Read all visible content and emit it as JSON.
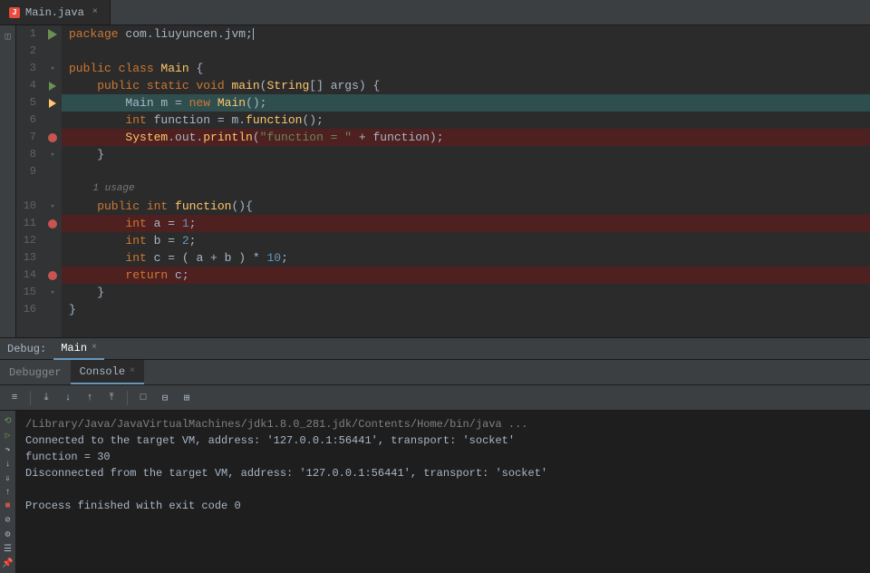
{
  "tab": {
    "label": "Main.java",
    "icon_text": "J"
  },
  "editor": {
    "lines": [
      {
        "num": 1,
        "type": "normal",
        "tokens": [
          {
            "t": "kw",
            "v": "package "
          },
          {
            "t": "pkg",
            "v": "com.liuyuncen.jvm"
          },
          {
            "t": "op",
            "v": ";"
          },
          {
            "t": "cursor",
            "v": ""
          }
        ]
      },
      {
        "num": 2,
        "type": "normal",
        "tokens": []
      },
      {
        "num": 3,
        "type": "normal",
        "tokens": [
          {
            "t": "kw",
            "v": "public "
          },
          {
            "t": "kw",
            "v": "class "
          },
          {
            "t": "cls",
            "v": "Main"
          },
          {
            "t": "op",
            "v": " {"
          }
        ]
      },
      {
        "num": 4,
        "type": "normal",
        "tokens": [
          {
            "t": "kw",
            "v": "    public "
          },
          {
            "t": "kw",
            "v": "static "
          },
          {
            "t": "kw",
            "v": "void "
          },
          {
            "t": "fn",
            "v": "main"
          },
          {
            "t": "op",
            "v": "("
          },
          {
            "t": "cls",
            "v": "String"
          },
          {
            "t": "op",
            "v": "[] args) {"
          }
        ]
      },
      {
        "num": 5,
        "type": "breakpoint",
        "tokens": [
          {
            "t": "var",
            "v": "        Main m = "
          },
          {
            "t": "kw",
            "v": "new "
          },
          {
            "t": "cls",
            "v": "Main"
          },
          {
            "t": "op",
            "v": "();"
          }
        ]
      },
      {
        "num": 6,
        "type": "normal",
        "tokens": [
          {
            "t": "kw",
            "v": "        int "
          },
          {
            "t": "var",
            "v": "function"
          },
          {
            "t": "op",
            "v": " = m."
          },
          {
            "t": "fn",
            "v": "function"
          },
          {
            "t": "op",
            "v": "();"
          }
        ]
      },
      {
        "num": 7,
        "type": "breakpoint",
        "tokens": [
          {
            "t": "cls",
            "v": "        System"
          },
          {
            "t": "op",
            "v": ".out."
          },
          {
            "t": "fn",
            "v": "println"
          },
          {
            "t": "op",
            "v": "("
          },
          {
            "t": "str",
            "v": "\"function = \""
          },
          {
            "t": "op",
            "v": " + function);"
          }
        ]
      },
      {
        "num": 8,
        "type": "normal",
        "tokens": [
          {
            "t": "op",
            "v": "    }"
          }
        ]
      },
      {
        "num": 9,
        "type": "normal",
        "tokens": []
      },
      {
        "num": 10,
        "type": "usage",
        "tokens": [
          {
            "t": "usage",
            "v": "1 usage"
          }
        ]
      },
      {
        "num": 10,
        "type": "normal",
        "tokens": [
          {
            "t": "kw",
            "v": "    public "
          },
          {
            "t": "kw",
            "v": "int "
          },
          {
            "t": "fn",
            "v": "function"
          },
          {
            "t": "op",
            "v": "(){"
          }
        ]
      },
      {
        "num": 11,
        "type": "breakpoint",
        "tokens": [
          {
            "t": "kw",
            "v": "        int "
          },
          {
            "t": "var",
            "v": "a"
          },
          {
            "t": "op",
            "v": " = "
          },
          {
            "t": "num",
            "v": "1"
          },
          {
            "t": "op",
            "v": ";"
          }
        ]
      },
      {
        "num": 12,
        "type": "normal",
        "tokens": [
          {
            "t": "kw",
            "v": "        int "
          },
          {
            "t": "var",
            "v": "b"
          },
          {
            "t": "op",
            "v": " = "
          },
          {
            "t": "num",
            "v": "2"
          },
          {
            "t": "op",
            "v": ";"
          }
        ]
      },
      {
        "num": 13,
        "type": "normal",
        "tokens": [
          {
            "t": "kw",
            "v": "        int "
          },
          {
            "t": "var",
            "v": "c"
          },
          {
            "t": "op",
            "v": " = ( a + b ) * "
          },
          {
            "t": "num",
            "v": "10"
          },
          {
            "t": "op",
            "v": ";"
          }
        ]
      },
      {
        "num": 14,
        "type": "breakpoint",
        "tokens": [
          {
            "t": "kw",
            "v": "        return "
          },
          {
            "t": "var",
            "v": "c"
          },
          {
            "t": "op",
            "v": ";"
          }
        ]
      },
      {
        "num": 15,
        "type": "normal",
        "tokens": [
          {
            "t": "op",
            "v": "    }"
          }
        ]
      },
      {
        "num": 16,
        "type": "normal",
        "tokens": [
          {
            "t": "op",
            "v": "}"
          }
        ]
      }
    ]
  },
  "debug_bar": {
    "label": "Debug:",
    "tabs": [
      {
        "label": "Main",
        "active": true
      }
    ]
  },
  "panel": {
    "tabs": [
      {
        "label": "Debugger",
        "active": false
      },
      {
        "label": "Console",
        "active": true
      }
    ],
    "toolbar_buttons": [
      "≡",
      "↓",
      "↓↓",
      "↑",
      "⊘",
      "□",
      "⊟",
      "⊞"
    ],
    "console_lines": [
      {
        "text": "/Library/Java/JavaVirtualMachines/jdk1.8.0_281.jdk/Contents/Home/bin/java ...",
        "cls": "cmd"
      },
      {
        "text": "Connected to the target VM, address: '127.0.0.1:56441', transport: 'socket'",
        "cls": "result"
      },
      {
        "text": "function = 30",
        "cls": "result"
      },
      {
        "text": "Disconnected from the target VM, address: '127.0.0.1:56441', transport: 'socket'",
        "cls": "disconnect"
      },
      {
        "text": "",
        "cls": ""
      },
      {
        "text": "Process finished with exit code 0",
        "cls": "exit"
      }
    ]
  },
  "debug_controls": [
    "▷",
    "⟳",
    "↓",
    "↑",
    "↻",
    "⏸",
    "⏹",
    "⊕",
    "⊘",
    "☰",
    "≡"
  ],
  "colors": {
    "breakpoint": "#c75450",
    "run_arrow": "#6a9153",
    "accent": "#6897bb"
  }
}
